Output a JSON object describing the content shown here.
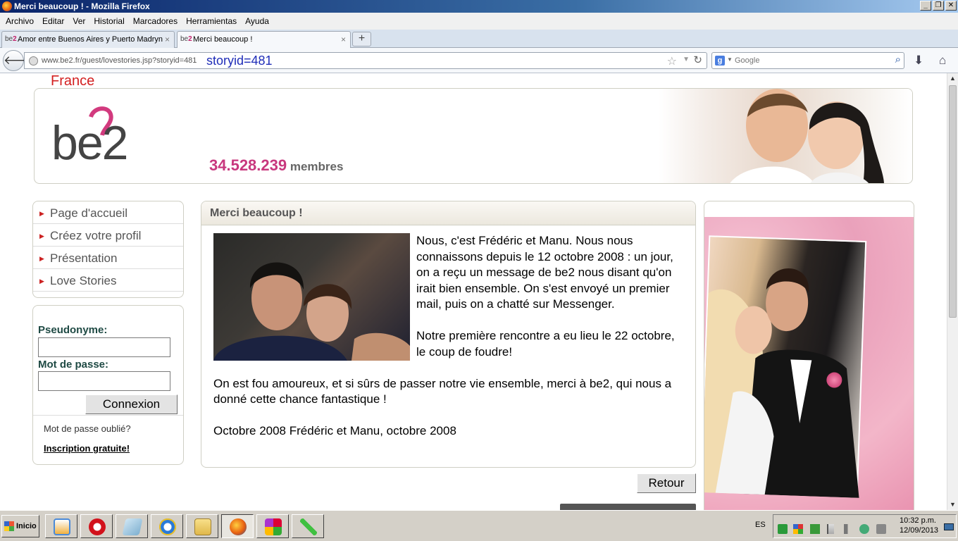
{
  "window": {
    "title": "Merci beaucoup ! - Mozilla Firefox"
  },
  "menu": {
    "items": [
      "Archivo",
      "Editar",
      "Ver",
      "Historial",
      "Marcadores",
      "Herramientas",
      "Ayuda"
    ]
  },
  "tabs": [
    {
      "label": "Amor entre Buenos Aires y Puerto Madryn",
      "active": false
    },
    {
      "label": "Merci beaucoup !",
      "active": true
    }
  ],
  "tab_favicon": {
    "prefix": "be",
    "suffix": "2"
  },
  "nav": {
    "url": "www.be2.fr/guest/lovestories.jsp?storyid=481",
    "url_highlight": "storyid=481",
    "search_placeholder": "Google"
  },
  "page": {
    "country": "France",
    "logo_text": "be2",
    "members_count": "34.528.239",
    "members_label": "membres",
    "sidebar": {
      "items": [
        "Page d'accueil",
        "Créez votre profil",
        "Présentation",
        "Love Stories"
      ]
    },
    "login": {
      "username_label": "Pseudonyme:",
      "password_label": "Mot de passe:",
      "connect_button": "Connexion",
      "forgot": "Mot de passe oublié?",
      "signup": "Inscription gratuite!"
    },
    "story": {
      "title": "Merci beaucoup !",
      "paragraphs": [
        "Nous, c'est Frédéric et Manu. Nous nous connaissons depuis le 12 octobre 2008 : un jour, on a reçu un message de be2 nous disant qu'on irait bien ensemble. On s'est envoyé un premier mail, puis on a chatté sur Messenger.",
        "Notre première rencontre a eu lieu le 22 octobre, le coup de foudre!",
        "On est fou amoureux, et si sûrs de passer notre vie ensemble, merci à be2, qui nous a donné cette chance fantastique !",
        "Octobre 2008 Frédéric et Manu, octobre 2008"
      ]
    },
    "back_button": "Retour"
  },
  "taskbar": {
    "start_label": "Inicio",
    "language": "ES",
    "time": "10:32 p.m.",
    "date": "12/09/2013"
  }
}
